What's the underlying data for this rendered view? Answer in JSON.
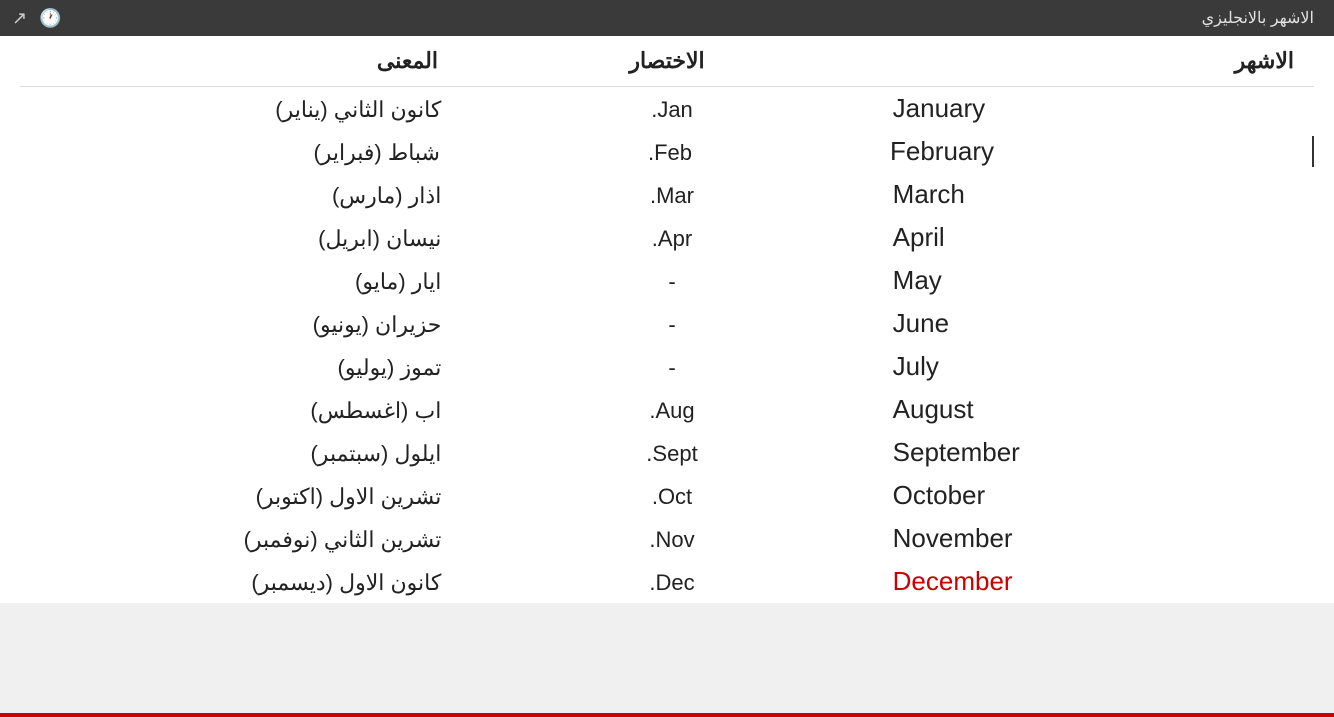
{
  "topBar": {
    "title": "الاشهر بالانجليزي",
    "icons": [
      "share-icon",
      "clock-icon"
    ]
  },
  "tableHeader": {
    "col1": "المعنى",
    "col2": "الاختصار",
    "col3": "الاشهر"
  },
  "months": [
    {
      "english": "January",
      "abbr": "Jan.",
      "arabic": "كانون الثاني (يناير)"
    },
    {
      "english": "February",
      "abbr": "Feb.",
      "arabic": "شباط (فبراير)"
    },
    {
      "english": "March",
      "abbr": "Mar.",
      "arabic": "اذار (مارس)"
    },
    {
      "english": "April",
      "abbr": "Apr.",
      "arabic": "نيسان (ابريل)"
    },
    {
      "english": "May",
      "abbr": "-",
      "arabic": "ايار (مايو)"
    },
    {
      "english": "June",
      "abbr": "-",
      "arabic": "حزيران (يونيو)"
    },
    {
      "english": "July",
      "abbr": "-",
      "arabic": "تموز (يوليو)"
    },
    {
      "english": "August",
      "abbr": "Aug.",
      "arabic": "اب (اغسطس)"
    },
    {
      "english": "September",
      "abbr": "Sept.",
      "arabic": "ايلول (سبتمبر)"
    },
    {
      "english": "October",
      "abbr": "Oct.",
      "arabic": "تشرين الاول (اكتوبر)"
    },
    {
      "english": "November",
      "abbr": "Nov.",
      "arabic": "تشرين الثاني (نوفمبر)"
    },
    {
      "english": "December",
      "abbr": "Dec.",
      "arabic": "كانون الاول (ديسمبر)"
    }
  ]
}
